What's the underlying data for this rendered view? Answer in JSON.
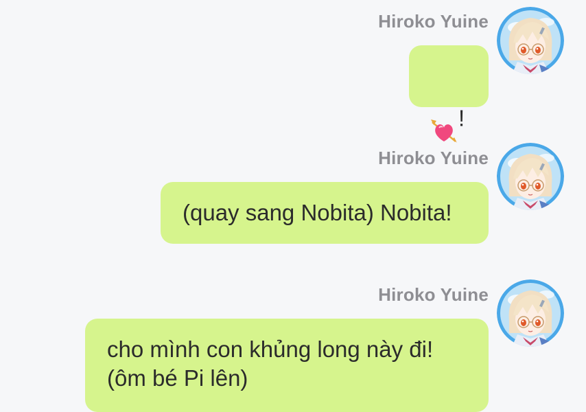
{
  "messages": [
    {
      "sender": "Hiroko Yuine",
      "emoji": "heart-with-arrow-icon",
      "text": "!"
    },
    {
      "sender": "Hiroko Yuine",
      "text": "(quay sang Nobita) Nobita!"
    },
    {
      "sender": "Hiroko Yuine",
      "text": "cho mình con khủng long này đi!\n(ôm bé Pi lên)"
    }
  ],
  "colors": {
    "bubble": "#d6f48d",
    "sender_name": "#8e8e93",
    "background": "#f6f7f9",
    "text": "#2b2b2b"
  }
}
